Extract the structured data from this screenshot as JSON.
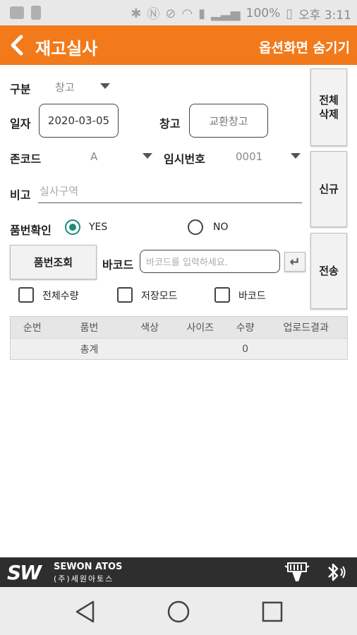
{
  "status_bar": {
    "battery_text": "100%",
    "time_text": "오후 3:11"
  },
  "header": {
    "title": "재고실사",
    "hide_options_label": "옵션화면 숨기기",
    "accent_color": "#f27a1a"
  },
  "form": {
    "category": {
      "label": "구분",
      "value": "창고"
    },
    "date": {
      "label": "일자",
      "value": "2020-03-05"
    },
    "warehouse": {
      "label": "창고",
      "value": "교환창고"
    },
    "zone_code": {
      "label": "존코드",
      "value": "A"
    },
    "temp_number": {
      "label": "임시번호",
      "value": "0001"
    },
    "remark": {
      "label": "비고",
      "placeholder": "실사구역"
    },
    "item_check": {
      "label": "품번확인",
      "options": [
        "YES",
        "NO"
      ],
      "selected": "YES"
    },
    "item_lookup_button": "품번조회",
    "barcode": {
      "label": "바코드",
      "placeholder": "바코드를 입력하세요."
    },
    "checkboxes": [
      "전체수량",
      "저장모드",
      "바코드"
    ]
  },
  "side_buttons": {
    "delete_all": "전체\n삭제",
    "new": "신규",
    "send": "전송"
  },
  "table": {
    "columns": [
      "순번",
      "품번",
      "색상",
      "사이즈",
      "수량",
      "업로드결과"
    ],
    "total_label": "총계",
    "total_qty": "0"
  },
  "footer": {
    "brand_mark": "SW",
    "brand_en": "SEWON ATOS",
    "brand_ko": "(주)세원아토스",
    "icons": [
      "scanner-icon",
      "bluetooth-icon"
    ]
  },
  "nav": {
    "icons": [
      "back-triangle-icon",
      "home-circle-icon",
      "recents-square-icon"
    ]
  }
}
